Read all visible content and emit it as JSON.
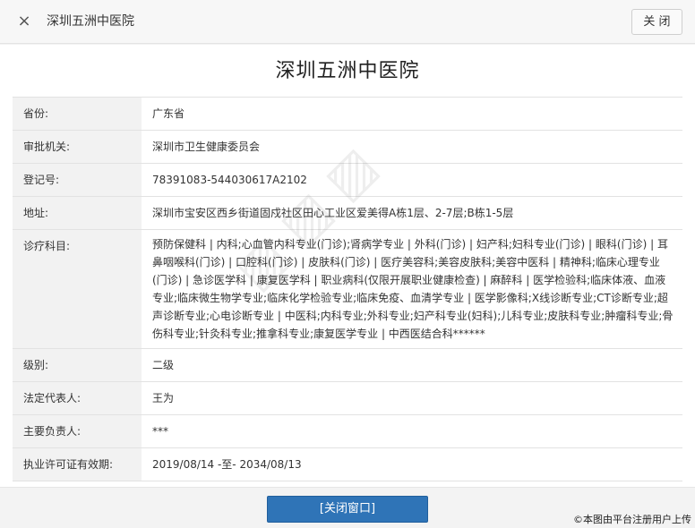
{
  "titlebar": {
    "close_icon": "×",
    "title": "深圳五洲中医院",
    "close_button": "关 闭"
  },
  "page_title": "深圳五洲中医院",
  "rows": [
    {
      "label": "省份:",
      "value": "广东省"
    },
    {
      "label": "审批机关:",
      "value": "深圳市卫生健康委员会"
    },
    {
      "label": "登记号:",
      "value": "78391083-544030617A2102"
    },
    {
      "label": "地址:",
      "value": "深圳市宝安区西乡街道固戍社区田心工业区爱美得A栋1层、2-7层;B栋1-5层"
    },
    {
      "label": "诊疗科目:",
      "value": "预防保健科 | 内科;心血管内科专业(门诊);肾病学专业 | 外科(门诊) | 妇产科;妇科专业(门诊) | 眼科(门诊) | 耳鼻咽喉科(门诊) | 口腔科(门诊) | 皮肤科(门诊) | 医疗美容科;美容皮肤科;美容中医科 | 精神科;临床心理专业(门诊) | 急诊医学科 | 康复医学科 | 职业病科(仅限开展职业健康检查) | 麻醉科 | 医学检验科;临床体液、血液专业;临床微生物学专业;临床化学检验专业;临床免疫、血清学专业 | 医学影像科;X线诊断专业;CT诊断专业;超声诊断专业;心电诊断专业 | 中医科;内科专业;外科专业;妇产科专业(妇科);儿科专业;皮肤科专业;肿瘤科专业;骨伤科专业;针灸科专业;推拿科专业;康复医学专业 | 中西医结合科******"
    },
    {
      "label": "级别:",
      "value": "二级"
    },
    {
      "label": "法定代表人:",
      "value": "王为"
    },
    {
      "label": "主要负责人:",
      "value": "***"
    },
    {
      "label": "执业许可证有效期:",
      "value": "2019/08/14 -至- 2034/08/13"
    }
  ],
  "footer": {
    "close_window_button": "[关闭窗口]",
    "upload_note": "©本图由平台注册用户上传"
  }
}
